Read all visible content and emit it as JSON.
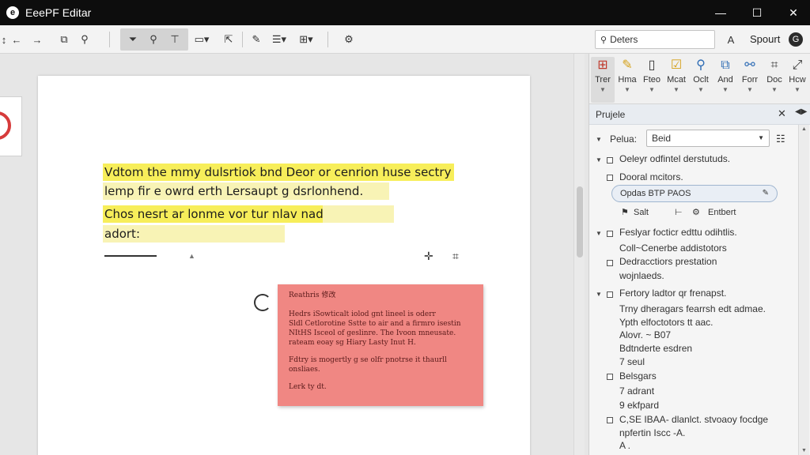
{
  "app": {
    "logo": "e",
    "title": "EeePF Editar"
  },
  "window": {
    "minimize": "—",
    "maximize": "☐",
    "close": "✕"
  },
  "toolbar": {
    "search_value": "Deters",
    "account_label": "Spourt",
    "avatar_letter": "G"
  },
  "document": {
    "highlights": [
      "Vdtom the mmy dulsrtiok bnd Deor or cenrion huse sectry",
      "lemp fir e owrd erth Lersaupt g dsrlonhend.",
      "Chos nesrt ar lonme vor tur nlav nad",
      "adort:"
    ],
    "note": {
      "title": "Reathris 修改",
      "p1": "Hedrs iSowticalt iolod gnt lineel is oderr\nSldl Cetlorotine Sstte to air and a firmro isestin\nNItHS Isceol of geslinre. The Ivoon mneusate.\nrateam eoay sg Hiary Lasty Inut H.",
      "p2": "Fdtry is mogertly g se olfr pnotrse it thaurll\nonsliaes.",
      "p3": "Lerk ty dt."
    }
  },
  "ribbon": {
    "items": [
      {
        "icon": "edit-text",
        "label": "Trer"
      },
      {
        "icon": "highlighter",
        "label": "Hma"
      },
      {
        "icon": "page",
        "label": "Fteo"
      },
      {
        "icon": "checkbox",
        "label": "Mcat"
      },
      {
        "icon": "search",
        "label": "Oclt"
      },
      {
        "icon": "picture",
        "label": "And"
      },
      {
        "icon": "link",
        "label": "Forr"
      },
      {
        "icon": "crop",
        "label": "Doc"
      },
      {
        "icon": "fit",
        "label": "Hcw"
      }
    ]
  },
  "panel": {
    "header": "Prujele",
    "close": "✕",
    "pin": "📌",
    "field_label": "Pelua:",
    "field_value": "Beid",
    "tree": [
      "Oeleyr odfintel derstutuds.",
      "Dooral mcitors.",
      "Opdas BTP PAOS",
      "Salt",
      "Entbert",
      "Feslyar focticr edttu odihtlis.",
      "Coll~Cenerbe addistotors",
      "Dedracctiors prestation",
      "wojnlaeds.",
      "Fertory ladtor qr frenapst.",
      "Trny dheragars fearrsh edt admae.",
      "Ypth elfoctotors tt aac.",
      "Alovr. ~ B07",
      "Bdtnderte esdren",
      "7 seul",
      "Belsgars",
      "7 adrant",
      "9 ekfpard",
      "C,SE IBAA- dlanlct. stvoaoy focdge",
      "npfertin Iscc -A.",
      "A ."
    ]
  }
}
